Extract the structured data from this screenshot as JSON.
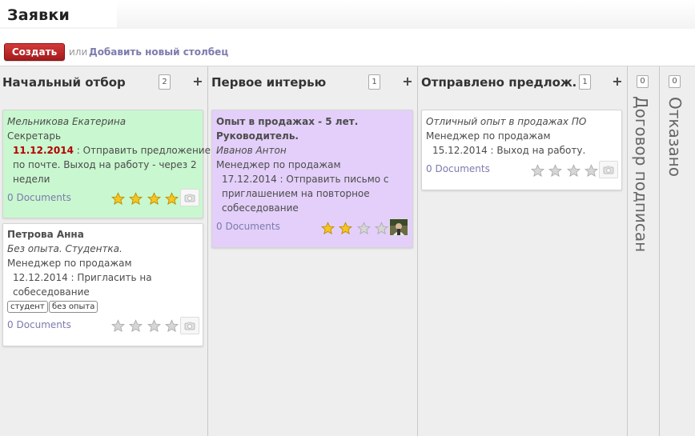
{
  "header": {
    "title": "Заявки"
  },
  "actions": {
    "create_label": "Создать",
    "or_label": "или",
    "add_column_label": "Добавить новый столбец"
  },
  "columns": [
    {
      "title": "Начальный отбор",
      "count": "2",
      "plus": "+",
      "cards": [
        {
          "name": "Мельникова Екатерина",
          "job": "Секретарь",
          "date": "11.12.2014",
          "action_line1": " : Отправить предложение",
          "action_line2": "по почте. Выход на работу - через 2",
          "action_line3": "недели",
          "documents": "0 Documents",
          "stars": 4,
          "color": "#c9f7cf"
        },
        {
          "name": "Петрова Анна",
          "subtitle": "Без опыта. Студентка.",
          "job": "Менеджер по продажам",
          "action_line1": "12.12.2014 : Пригласить на",
          "action_line2": "собеседование",
          "tags": [
            "студент",
            "без опыта"
          ],
          "documents": "0 Documents",
          "stars": 0,
          "color": "#ffffff"
        }
      ]
    },
    {
      "title": "Первое интерью",
      "count": "1",
      "plus": "+",
      "cards": [
        {
          "title_line1": "Опыт в продажах - 5 лет.",
          "title_line2": "Руководитель.",
          "name": "Иванов Антон",
          "job": "Менеджер по продажам",
          "action_line1": "17.12.2014 : Отправить письмо с",
          "action_line2": "приглашением на повторное",
          "action_line3": "собеседование",
          "documents": "0 Documents",
          "stars": 2,
          "color": "#e3cff9"
        }
      ]
    },
    {
      "title": "Отправлено предлож…",
      "count": "1",
      "plus": "+",
      "cards": [
        {
          "subtitle": "Отличный опыт в продажах ПО",
          "job": "Менеджер по продажам",
          "action_line1": "15.12.2014 : Выход на работу.",
          "documents": "0 Documents",
          "stars": 0,
          "color": "#ffffff"
        }
      ]
    },
    {
      "title": "Договор подписан",
      "count": "0"
    },
    {
      "title": "Отказано",
      "count": "0"
    }
  ],
  "colors": {
    "accent_button": "#b92a2a",
    "link": "#7c7bad",
    "date_overdue": "#b30000",
    "star_filled": "#f7c51e",
    "star_empty": "#cfcfcf"
  },
  "icons": {
    "star": "star-icon",
    "camera": "camera-icon",
    "avatar": "avatar-photo"
  }
}
